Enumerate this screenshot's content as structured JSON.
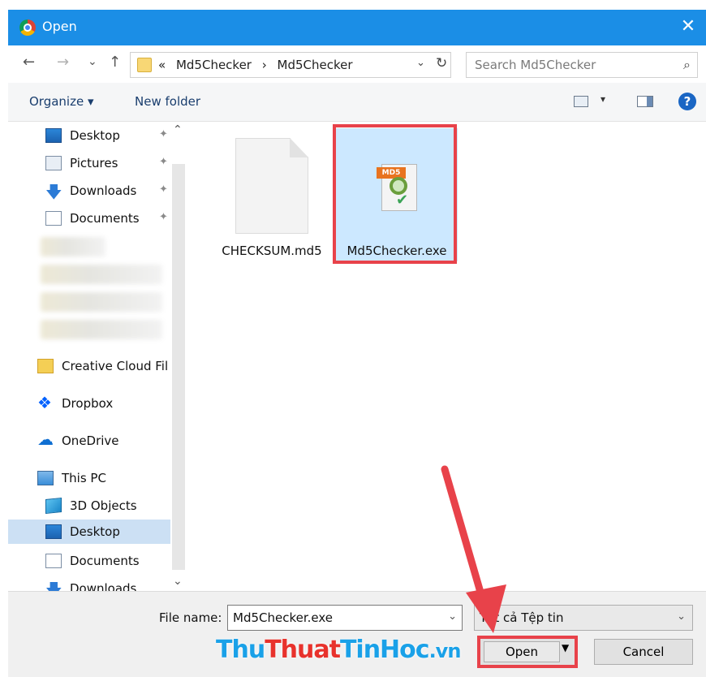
{
  "window": {
    "title": "Open",
    "close_glyph": "✕"
  },
  "nav_buttons": {
    "back": "←",
    "forward": "→",
    "recent": "⌄",
    "up": "↑"
  },
  "address": {
    "crumbs": [
      "«",
      "Md5Checker",
      "›",
      "Md5Checker"
    ],
    "dropdown_glyph": "⌄",
    "refresh_glyph": "↻"
  },
  "search": {
    "placeholder": "Search Md5Checker",
    "icon_glyph": "⌕"
  },
  "toolbar": {
    "organize_label": "Organize ▾",
    "new_folder_label": "New folder",
    "view_dropdown_glyph": "▾",
    "help_glyph": "?"
  },
  "navpane": {
    "quick_access": [
      {
        "label": "Desktop",
        "icon": "desktop-icon"
      },
      {
        "label": "Pictures",
        "icon": "pictures-icon"
      },
      {
        "label": "Downloads",
        "icon": "downloads-icon"
      },
      {
        "label": "Documents",
        "icon": "documents-icon"
      }
    ],
    "pin_glyph": "✦",
    "creative_cloud": "Creative Cloud Fil",
    "dropbox": "Dropbox",
    "onedrive": "OneDrive",
    "this_pc": "This PC",
    "pc_items": [
      {
        "label": "3D Objects",
        "icon": "3d-objects-icon"
      },
      {
        "label": "Desktop",
        "icon": "desktop-icon"
      },
      {
        "label": "Documents",
        "icon": "documents-icon"
      },
      {
        "label": "Downloads",
        "icon": "downloads-icon"
      }
    ],
    "scroll_up_glyph": "⌃",
    "scroll_down_glyph": "⌄"
  },
  "files": [
    {
      "name": "CHECKSUM.md5",
      "icon": "md5-file-icon"
    },
    {
      "name": "Md5Checker.exe",
      "icon": "md5checker-app-icon",
      "selected": true
    }
  ],
  "exe_icon_tag": "MD5",
  "exe_icon_check": "✔",
  "footer": {
    "file_name_label": "File name:",
    "file_name_value": "Md5Checker.exe",
    "file_name_drop": "⌄",
    "filter_value": "Tất cả Tệp tin",
    "filter_drop": "⌄",
    "open_label": "Open",
    "open_split_glyph": "▼",
    "cancel_label": "Cancel"
  },
  "watermark": {
    "part1": "Thu",
    "part2": "Thuat",
    "part3": "TinHoc",
    "part4": ".vn"
  },
  "colors": {
    "titlebar": "#1b8ee6",
    "highlight": "#e8424a",
    "selection": "#cce8ff"
  }
}
